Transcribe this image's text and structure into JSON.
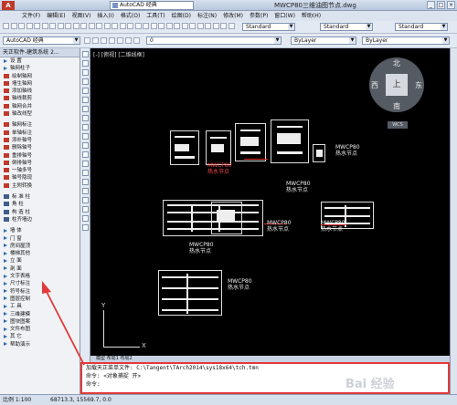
{
  "titlebar": {
    "logo": "A",
    "workspace": "AutoCAD 经典",
    "title": "MWCP80三维油图节点.dwg",
    "min": "_",
    "max": "□",
    "close": "×"
  },
  "menu": [
    "文件(F)",
    "编辑(E)",
    "视图(V)",
    "插入(I)",
    "格式(O)",
    "工具(T)",
    "绘图(D)",
    "标注(N)",
    "修改(M)",
    "参数(P)",
    "窗口(W)",
    "帮助(H)"
  ],
  "toolbar": {
    "style1": "Standard",
    "style2": "Standard",
    "style3": "Standard",
    "workspace": "AutoCAD 经典",
    "layer": "0",
    "color": "ByLayer",
    "linetype": "ByLayer"
  },
  "leftpanel": {
    "title": "天正软件-建筑系统 2...",
    "items": [
      {
        "t": "设  置",
        "k": "grp"
      },
      {
        "t": "轴网柱子",
        "k": "grp"
      },
      {
        "t": "绘制轴网",
        "k": "sub"
      },
      {
        "t": "墙生轴网",
        "k": "sub"
      },
      {
        "t": "添加轴线",
        "k": "sub"
      },
      {
        "t": "轴线裁剪",
        "k": "sub"
      },
      {
        "t": "轴网合并",
        "k": "sub"
      },
      {
        "t": "轴改线型",
        "k": "sub"
      },
      {
        "t": "",
        "k": "sep"
      },
      {
        "t": "轴网标注",
        "k": "sub"
      },
      {
        "t": "单轴标注",
        "k": "sub"
      },
      {
        "t": "添补轴号",
        "k": "sub"
      },
      {
        "t": "删除轴号",
        "k": "sub"
      },
      {
        "t": "重排轴号",
        "k": "sub"
      },
      {
        "t": "倒排轴号",
        "k": "sub"
      },
      {
        "t": "一轴多号",
        "k": "sub"
      },
      {
        "t": "轴号隐现",
        "k": "sub"
      },
      {
        "t": "主附转换",
        "k": "sub"
      },
      {
        "t": "",
        "k": "sep"
      },
      {
        "t": "标 准 柱",
        "k": "hdr"
      },
      {
        "t": "角    柱",
        "k": "hdr"
      },
      {
        "t": "构 造 柱",
        "k": "hdr"
      },
      {
        "t": "柱齐墙边",
        "k": "hdr"
      },
      {
        "t": "",
        "k": "sep"
      },
      {
        "t": "墙    体",
        "k": "grp"
      },
      {
        "t": "门    窗",
        "k": "grp"
      },
      {
        "t": "房间屋顶",
        "k": "grp"
      },
      {
        "t": "楼梯其他",
        "k": "grp"
      },
      {
        "t": "立    面",
        "k": "grp"
      },
      {
        "t": "剖    面",
        "k": "grp"
      },
      {
        "t": "文字表格",
        "k": "grp"
      },
      {
        "t": "尺寸标注",
        "k": "grp"
      },
      {
        "t": "符号标注",
        "k": "grp"
      },
      {
        "t": "图层控制",
        "k": "grp"
      },
      {
        "t": "工    具",
        "k": "grp"
      },
      {
        "t": "三维建模",
        "k": "grp"
      },
      {
        "t": "图块图案",
        "k": "grp"
      },
      {
        "t": "文件布图",
        "k": "grp"
      },
      {
        "t": "其    它",
        "k": "grp"
      },
      {
        "t": "帮助演示",
        "k": "grp"
      }
    ]
  },
  "canvas": {
    "viewport_label": "[-] [俯视] [二维线框]",
    "compass": {
      "n": "北",
      "s": "南",
      "w": "西",
      "e": "东",
      "top": "上"
    },
    "wcs": "WCS",
    "labels": [
      "MWCP80\n热水节点",
      "MWCP80\n热水节点",
      "MWCP80\n热水节点",
      "MWCP80\n热水节点",
      "MWCP80\n热水节点",
      "MWCP80\n热水节点",
      "MWCP80\n热水节点"
    ],
    "ucs": {
      "x": "X",
      "y": "Y"
    }
  },
  "tabs": "模型  布局1  布局2",
  "command": {
    "line1": "加载天正菜单文件: C:\\Tangent\\TArch2014\\sys18x64\\tch.tmn",
    "line2": "命令:  <对象捕捉 开>",
    "line3": "命令:"
  },
  "status": {
    "scale": "比例 1:100",
    "coords": "68713.3, 15569.7, 0.0"
  },
  "watermark": "Bai 经验"
}
